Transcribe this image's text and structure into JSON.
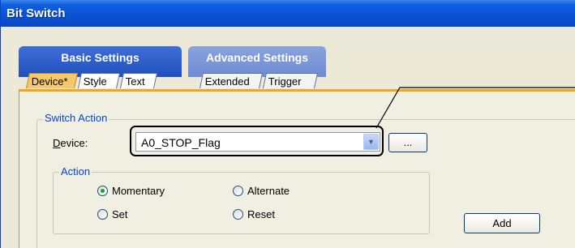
{
  "window": {
    "title": "Bit Switch"
  },
  "tab_groups": [
    {
      "label": "Basic Settings",
      "tabs": [
        "Device*",
        "Style",
        "Text"
      ]
    },
    {
      "label": "Advanced Settings",
      "tabs": [
        "Extended",
        "Trigger"
      ]
    }
  ],
  "switch_action": {
    "legend": "Switch Action",
    "device_label": "Device:",
    "device_value": "A0_STOP_Flag",
    "browse_label": "...",
    "action": {
      "legend": "Action",
      "options": [
        "Momentary",
        "Alternate",
        "Set",
        "Reset"
      ],
      "selected": "Momentary"
    },
    "add_label": "Add"
  },
  "icons": {
    "dropdown": "chevron-down-icon"
  },
  "colors": {
    "titlebar": "#0a52d6",
    "active_tab": "#f5c96a",
    "accent": "#f0a81e",
    "legend": "#0046d5"
  }
}
